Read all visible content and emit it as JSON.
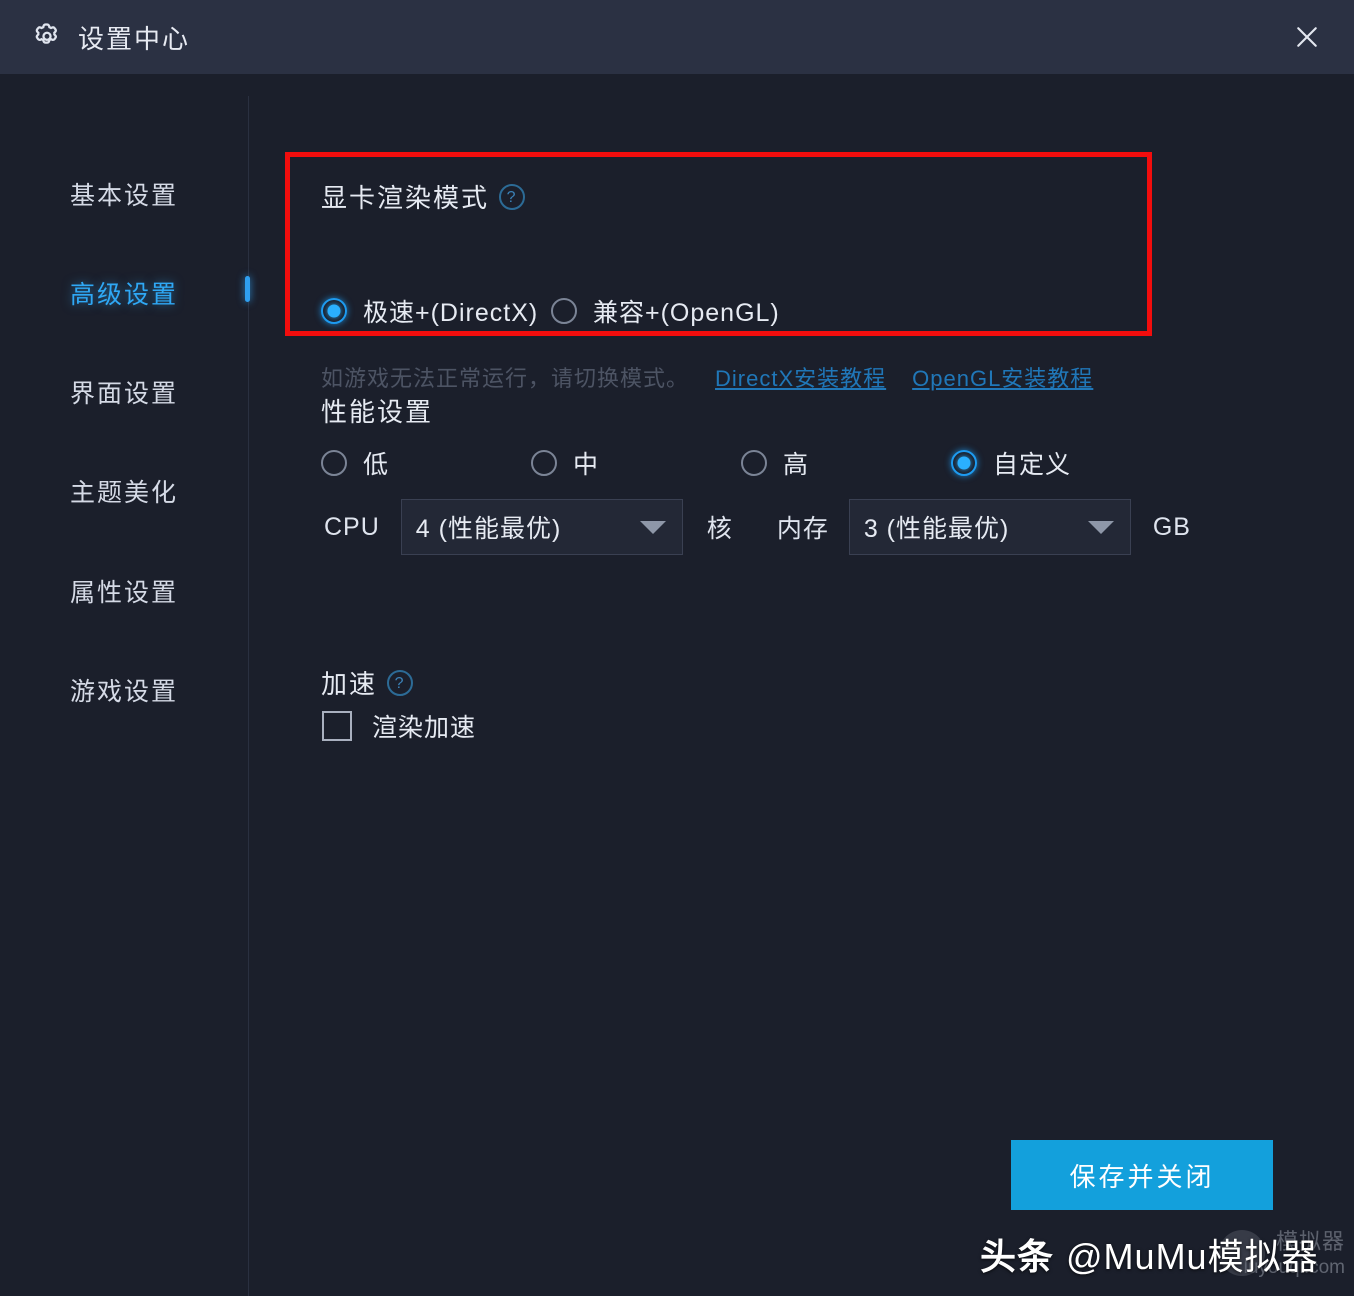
{
  "window": {
    "title": "设置中心",
    "gear_icon": "gear-icon",
    "close_icon": "close-icon",
    "titlebar_bg": "#2b3143",
    "body_bg": "#1b1f2b"
  },
  "sidebar": {
    "items": [
      {
        "label": "基本设置",
        "active": false
      },
      {
        "label": "高级设置",
        "active": true
      },
      {
        "label": "界面设置",
        "active": false
      },
      {
        "label": "主题美化",
        "active": false
      },
      {
        "label": "属性设置",
        "active": false
      },
      {
        "label": "游戏设置",
        "active": false
      }
    ],
    "active_color": "#2fa8f5",
    "inactive_color": "#d5dae6"
  },
  "highlight": {
    "border_color": "#f20d0d"
  },
  "render_mode": {
    "title": "显卡渲染模式",
    "help_icon": "question-mark-icon",
    "options": [
      {
        "label": "极速+(DirectX)",
        "checked": true
      },
      {
        "label": "兼容+(OpenGL)",
        "checked": false
      }
    ],
    "hint": "如游戏无法正常运行，请切换模式。",
    "links": [
      {
        "label": "DirectX安装教程"
      },
      {
        "label": "OpenGL安装教程"
      }
    ],
    "link_color": "#2077b8"
  },
  "performance": {
    "title": "性能设置",
    "presets": [
      {
        "label": "低",
        "checked": false
      },
      {
        "label": "中",
        "checked": false
      },
      {
        "label": "高",
        "checked": false
      },
      {
        "label": "自定义",
        "checked": true
      }
    ],
    "cpu": {
      "label": "CPU",
      "value": "4 (性能最优)",
      "unit": "核",
      "caret_icon": "chevron-down-icon"
    },
    "memory": {
      "label": "内存",
      "value": "3 (性能最优)",
      "unit": "GB",
      "caret_icon": "chevron-down-icon"
    }
  },
  "acceleration": {
    "title": "加速",
    "help_icon": "question-mark-icon",
    "checkbox": {
      "label": "渲染加速",
      "checked": false
    }
  },
  "footer": {
    "save_label": "保存并关闭",
    "save_color": "#13a0dc"
  },
  "watermark": {
    "brand": "头条",
    "account": "@MuMu模拟器",
    "secondary_cn": "模拟器",
    "url": "luyouqi.com"
  }
}
